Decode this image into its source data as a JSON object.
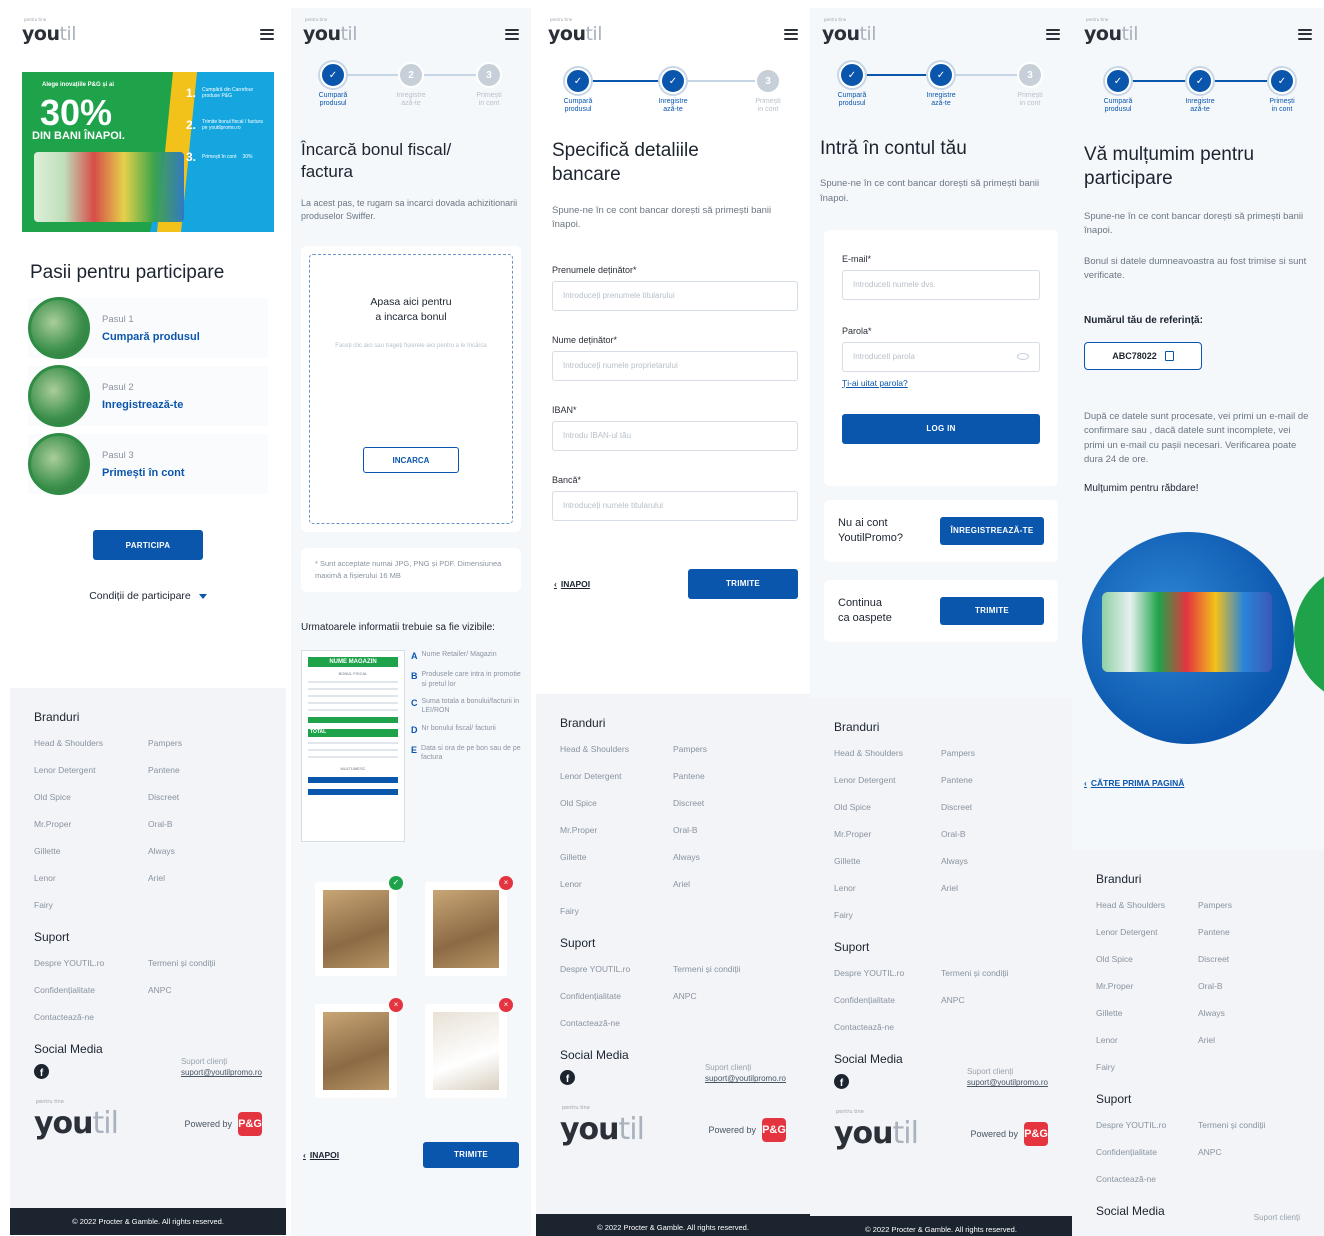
{
  "brand": {
    "logo_main": "you",
    "logo_light": "til",
    "logo_tag": "pentru tine",
    "powered_by": "Powered by",
    "pg": "P&G"
  },
  "steps": [
    {
      "label": "Cumpară\nprodusul"
    },
    {
      "label": "Inregistre\nază-te"
    },
    {
      "label": "Primești\nin cont"
    }
  ],
  "step_numbers": [
    "2",
    "3"
  ],
  "screen1": {
    "promo": {
      "headline": "Alege inovațiile P&G și ai",
      "percent": "30%",
      "sub": "DIN BANI ÎNAPOI.",
      "step1_text": "Cumpără din Carrefour produse P&G",
      "step2_text": "Trimite bonul fiscal / factura pe youtilpromo.ro",
      "step3_text": "Primești în cont",
      "step3_box": "30%"
    },
    "title": "Pasii pentru participare",
    "pasi": [
      {
        "n": "Pasul 1",
        "t": "Cumpară produsul"
      },
      {
        "n": "Pasul 2",
        "t": "Inregistrează-te"
      },
      {
        "n": "Pasul 3",
        "t": "Primești în cont"
      }
    ],
    "cta": "PARTICIPA",
    "conditions": "Condiții de participare"
  },
  "screen2": {
    "title": "Încarcă bonul fiscal/\nfactura",
    "desc": "La acest pas, te rugam sa incarci dovada achizitionarii produselor Swiffer.",
    "upload_heading": "Apasa aici pentru\na incarca bonul",
    "upload_sub": "Faceți clic aici sau trageți fișierele aici pentru a le încărca",
    "upload_btn": "INCARCA",
    "note": "* Sunt acceptate numai JPG, PNG și PDF. Dimensiunea maximă a fișierului 16 MB",
    "visible": "Urmatoarele informatii trebuie sa fie vizibile:",
    "receipt": {
      "store": "NUME MAGAZIN",
      "fiscal": "BONUL FISCAL",
      "total": "TOTAL",
      "multumesc": "MULTUMESC"
    },
    "legend": [
      {
        "k": "A",
        "v": "Nume Retailer/ Magazin"
      },
      {
        "k": "B",
        "v": "Produsele care intra in promotie si pretul lor"
      },
      {
        "k": "C",
        "v": "Suma totala a bonului/facturii in LEI/RON"
      },
      {
        "k": "D",
        "v": "Nr bonului fiscal/ facturii"
      },
      {
        "k": "E",
        "v": "Data si ora de pe bon sau de pe factura"
      }
    ],
    "back": "INAPOI",
    "submit": "TRIMITE"
  },
  "screen3": {
    "title": "Specifică detaliile\nbancare",
    "desc": "Spune-ne în ce cont bancar dorești să primești banii înapoi.",
    "fields": [
      {
        "label": "Prenumele deținător*",
        "placeholder": "Introduceți prenumele titularului"
      },
      {
        "label": "Nume deținător*",
        "placeholder": "Introduceți numele proprietarului"
      },
      {
        "label": "IBAN*",
        "placeholder": "Introdu IBAN-ul tău"
      },
      {
        "label": "Bancă*",
        "placeholder": "Introduceți numele titularului"
      }
    ],
    "back": "INAPOI",
    "submit": "TRIMITE"
  },
  "screen4": {
    "title": "Intră în contul tău",
    "desc": "Spune-ne în ce cont bancar dorești să primești banii înapoi.",
    "email_label": "E-mail*",
    "email_placeholder": "Introduceti numele dvs.",
    "password_label": "Parola*",
    "password_placeholder": "Introduceti parola",
    "forgot": "Ți-ai uitat parola?",
    "login": "LOG IN",
    "no_account": "Nu ai cont\nYoutilPromo?",
    "register": "ÎNREGISTREAZĂ-TE",
    "guest": "Continua\nca oaspete",
    "guest_btn": "TRIMITE"
  },
  "screen5": {
    "title": "Vă mulțumim pentru\nparticipare",
    "desc1": "Spune-ne în ce cont bancar dorești să primești banii înapoi.",
    "desc2": "Bonul si datele dumneavoastra au fost trimise si sunt verificate.",
    "ref_label": "Numărul tău de referință:",
    "ref": "ABC78022",
    "info": "După ce datele sunt procesate, vei primi un e-mail de confirmare sau , dacă datele sunt incomplete, vei primi un e-mail cu pașii necesari. Verificarea poate dura 24 de ore.",
    "thanks": "Mulțumim pentru răbdare!",
    "home": "CĂTRE PRIMA PAGINĂ"
  },
  "footer": {
    "brands_title": "Branduri",
    "brands": [
      "Head & Shoulders",
      "Pampers",
      "Lenor Detergent",
      "Pantene",
      "Old Spice",
      "Discreet",
      "Mr.Proper",
      "Oral-B",
      "Gillette",
      "Always",
      "Lenor",
      "Ariel",
      "Fairy"
    ],
    "support_title": "Suport",
    "support": [
      "Despre YOUTIL.ro",
      "Termeni și condiții",
      "Confidențialitate",
      "ANPC",
      "Contactează-ne"
    ],
    "social_title": "Social Media",
    "support_client_label": "Suport clienți",
    "support_email": "suport@youtilpromo.ro",
    "fb": "f",
    "copyright": "© 2022 Procter & Gamble. All rights reserved."
  }
}
